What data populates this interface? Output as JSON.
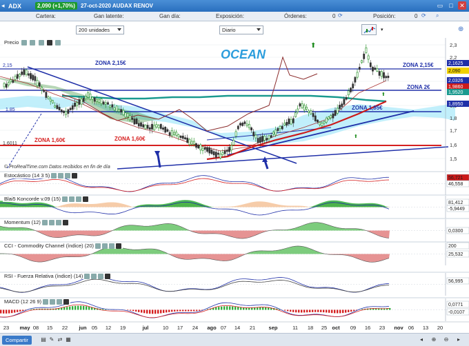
{
  "titlebar": {
    "symbol": "ADX",
    "change": "2,090 (+1,70%)",
    "date_name": "27-oct-2020  AUDAX RENOV"
  },
  "infobar": {
    "cartera": "Cartera:",
    "latente": "Gan latente:",
    "dia": "Gan día:",
    "exposicion": "Exposición:",
    "ordenes": "Órdenes:",
    "ordenes_val": "0",
    "posicion": "Posición:",
    "posicion_val": "0"
  },
  "toolbar": {
    "units": "200 unidades",
    "period": "Diario"
  },
  "chart": {
    "main_title": "OCEAN",
    "price_label": "Precio",
    "source": "© ProRealTime.com  Datos recibidos en fin de día",
    "zones": [
      "ZONA 2,15€",
      "ZONA 2,15€",
      "ZONA 2€",
      "ZONA 1,85€",
      "ZONA 1,60€",
      "ZONA 1,60€"
    ],
    "price_axis": [
      "2,3",
      "2,2",
      "2",
      "1,9",
      "1,8",
      "1,7",
      "1,6",
      "1,5"
    ],
    "price_tags": [
      "2,1625",
      "2,090",
      "2,0326",
      "1,9860",
      "1,9520",
      "1,8950"
    ],
    "left_tags": [
      "2,15",
      "1,85",
      "1,6011"
    ],
    "colors": {
      "up": "#1a8a1a",
      "down": "#333333",
      "zone_line": "#1f2fa8",
      "zone_red": "#d62020",
      "cloud": "#b6ecfa"
    }
  },
  "indicators": [
    {
      "label": "Estocástico (14 3 5)",
      "tags": [
        "56,721",
        "46,558"
      ]
    },
    {
      "label": "Blai5 Koncorde v.09 (15)",
      "tags": [
        "81,412",
        "-5,9449"
      ]
    },
    {
      "label": "Momentum (12)",
      "tags": [
        "0,0300"
      ]
    },
    {
      "label": "CCI - Commodity Channel (índice) (20)",
      "tags": [
        "200",
        "25,532"
      ]
    },
    {
      "label": "RSI - Fuerza Relativa (índice) (14)",
      "tags": [
        "56,995"
      ]
    },
    {
      "label": "MACD (12 26 9)",
      "tags": [
        "0,0771",
        "-0,0107"
      ]
    }
  ],
  "xaxis": [
    "23",
    "may",
    "08",
    "15",
    "22",
    "jun",
    "05",
    "12",
    "19",
    "jul",
    "10",
    "17",
    "24",
    "ago",
    "07",
    "14",
    "21",
    "sep",
    "11",
    "18",
    "25",
    "oct",
    "09",
    "16",
    "23",
    "nov",
    "06",
    "13",
    "20"
  ],
  "bottom": {
    "share": "Compartir"
  }
}
